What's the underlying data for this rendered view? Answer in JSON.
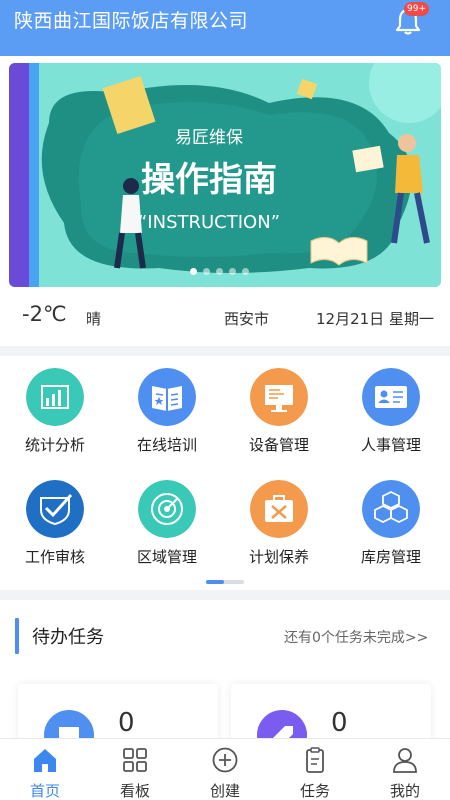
{
  "header": {
    "title": "陕西曲江国际饭店有限公司",
    "notification_badge": "99+"
  },
  "banner": {
    "brand": "易匠维保",
    "headline": "操作指南",
    "subline": "“INSTRUCTION”",
    "slide_count": 5,
    "active_slide": 1
  },
  "weather": {
    "temperature": "-2℃",
    "condition": "晴",
    "city": "西安市",
    "date": "12月21日 星期一"
  },
  "modules": [
    {
      "label": "统计分析",
      "icon": "bar-chart-icon",
      "color": "#39c9b6"
    },
    {
      "label": "在线培训",
      "icon": "book-icon",
      "color": "#4f8ff0"
    },
    {
      "label": "设备管理",
      "icon": "monitor-icon",
      "color": "#f39a4d"
    },
    {
      "label": "人事管理",
      "icon": "id-card-icon",
      "color": "#4f8ff0"
    },
    {
      "label": "工作审核",
      "icon": "check-shield-icon",
      "color": "#1f6fc4"
    },
    {
      "label": "区域管理",
      "icon": "radar-icon",
      "color": "#39c9b6"
    },
    {
      "label": "计划保养",
      "icon": "toolbox-icon",
      "color": "#f39a4d"
    },
    {
      "label": "库房管理",
      "icon": "cubes-icon",
      "color": "#4f8ff0"
    }
  ],
  "todo": {
    "title": "待办任务",
    "more": "还有0个任务未完成>>"
  },
  "stats": [
    {
      "value": "0",
      "icon": "message-icon",
      "color": "#4f8ff0"
    },
    {
      "value": "0",
      "icon": "tag-icon",
      "color": "#7a5cf0"
    }
  ],
  "tabs": [
    {
      "label": "首页",
      "icon": "home-icon"
    },
    {
      "label": "看板",
      "icon": "grid-icon"
    },
    {
      "label": "创建",
      "icon": "plus-circle-icon"
    },
    {
      "label": "任务",
      "icon": "clipboard-icon"
    },
    {
      "label": "我的",
      "icon": "user-icon"
    }
  ],
  "active_tab": 0,
  "colors": {
    "header": "#5b9cf5",
    "accent": "#3c87f0",
    "badge": "#f04b4b"
  }
}
